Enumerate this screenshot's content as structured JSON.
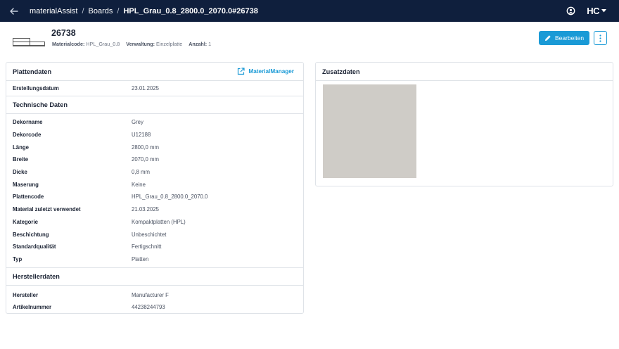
{
  "breadcrumb": {
    "app": "materialAssist",
    "section": "Boards",
    "current": "HPL_Grau_0.8_2800.0_2070.0#26738"
  },
  "header": {
    "title": "26738",
    "meta": [
      {
        "label": "Materialcode:",
        "value": "HPL_Grau_0.8"
      },
      {
        "label": "Verwaltung:",
        "value": "Einzelplatte"
      },
      {
        "label": "Anzahl:",
        "value": "1"
      }
    ],
    "edit_label": "Bearbeiten",
    "logo_text": "HC"
  },
  "left_card": {
    "title": "Plattendaten",
    "link_label": "MaterialManager",
    "general_rows": [
      {
        "key": "Erstellungsdatum",
        "value": "23.01.2025"
      }
    ],
    "tech_title": "Technische Daten",
    "tech_rows": [
      {
        "key": "Dekorname",
        "value": "Grey"
      },
      {
        "key": "Dekorcode",
        "value": "U12188"
      },
      {
        "key": "Länge",
        "value": "2800,0 mm"
      },
      {
        "key": "Breite",
        "value": "2070,0 mm"
      },
      {
        "key": "Dicke",
        "value": "0,8 mm"
      },
      {
        "key": "Maserung",
        "value": "Keine"
      },
      {
        "key": "Plattencode",
        "value": "HPL_Grau_0.8_2800.0_2070.0"
      },
      {
        "key": "Material zuletzt verwendet",
        "value": "21.03.2025"
      },
      {
        "key": "Kategorie",
        "value": "Kompaktplatten (HPL)"
      },
      {
        "key": "Beschichtung",
        "value": "Unbeschichtet"
      },
      {
        "key": "Standardqualität",
        "value": "Fertigschnitt"
      },
      {
        "key": "Typ",
        "value": "Platten"
      }
    ],
    "maker_title": "Herstellerdaten",
    "maker_rows": [
      {
        "key": "Hersteller",
        "value": "Manufacturer F"
      },
      {
        "key": "Artikelnummer",
        "value": "44238244793"
      }
    ]
  },
  "right_card": {
    "title": "Zusatzdaten",
    "swatch_color": "#cfccc7"
  },
  "colors": {
    "topbar": "#0f1f3d",
    "accent": "#1a9ad6"
  }
}
